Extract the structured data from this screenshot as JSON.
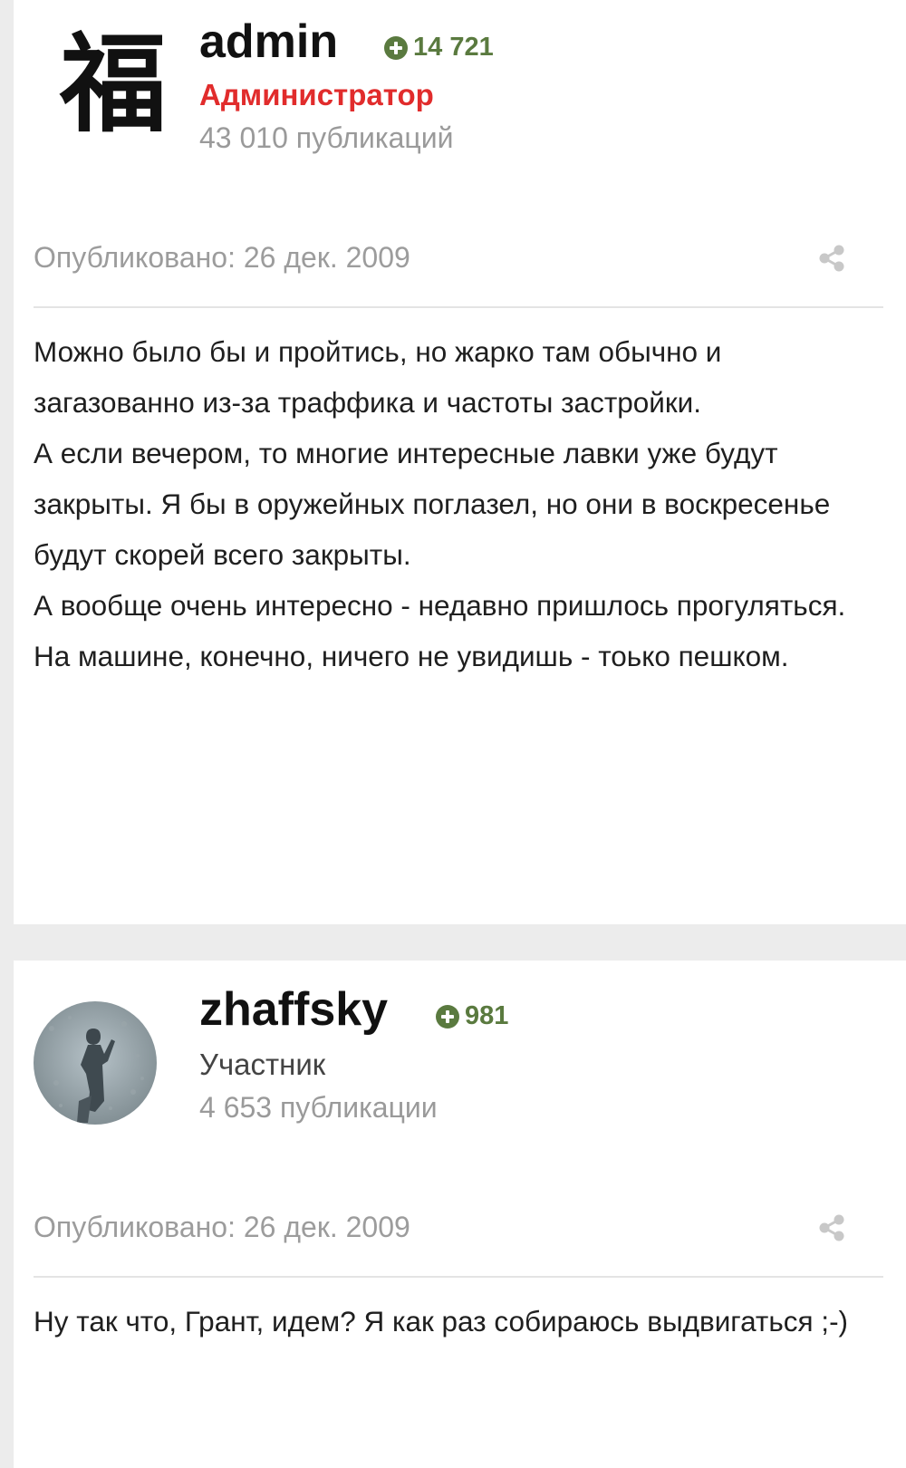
{
  "posts": [
    {
      "author": "admin",
      "avatar_glyph": "福",
      "reputation": "14 721",
      "role": "Администратор",
      "post_count": "43 010 публикаций",
      "published": "Опубликовано: 26 дек. 2009",
      "body": [
        "Можно было бы и пройтись, но жарко там обычно и загазованно из-за траффика и частоты застройки.",
        "А если вечером, то многие интересные лавки уже будут закрыты. Я бы в оружейных поглазел, но они в воскресенье будут скорей всего закрыты.",
        "А вообще очень интересно - недавно пришлось прогуляться.",
        "На машине, конечно, ничего не увидишь - тоько пешком."
      ]
    },
    {
      "author": "zhaffsky",
      "reputation": "981",
      "role": "Участник",
      "post_count": "4 653 публикации",
      "published": "Опубликовано: 26 дек. 2009",
      "body": [
        "Ну так что, Грант, идем? Я как раз собираюсь выдвигаться ;-)"
      ]
    }
  ],
  "icons": {
    "reputation": "plus-circle-icon",
    "share": "share-icon"
  },
  "colors": {
    "reputation": "#5a7a3f",
    "admin_role": "#e12c2c",
    "muted": "#9c9c9c",
    "page_bg": "#ececec"
  }
}
